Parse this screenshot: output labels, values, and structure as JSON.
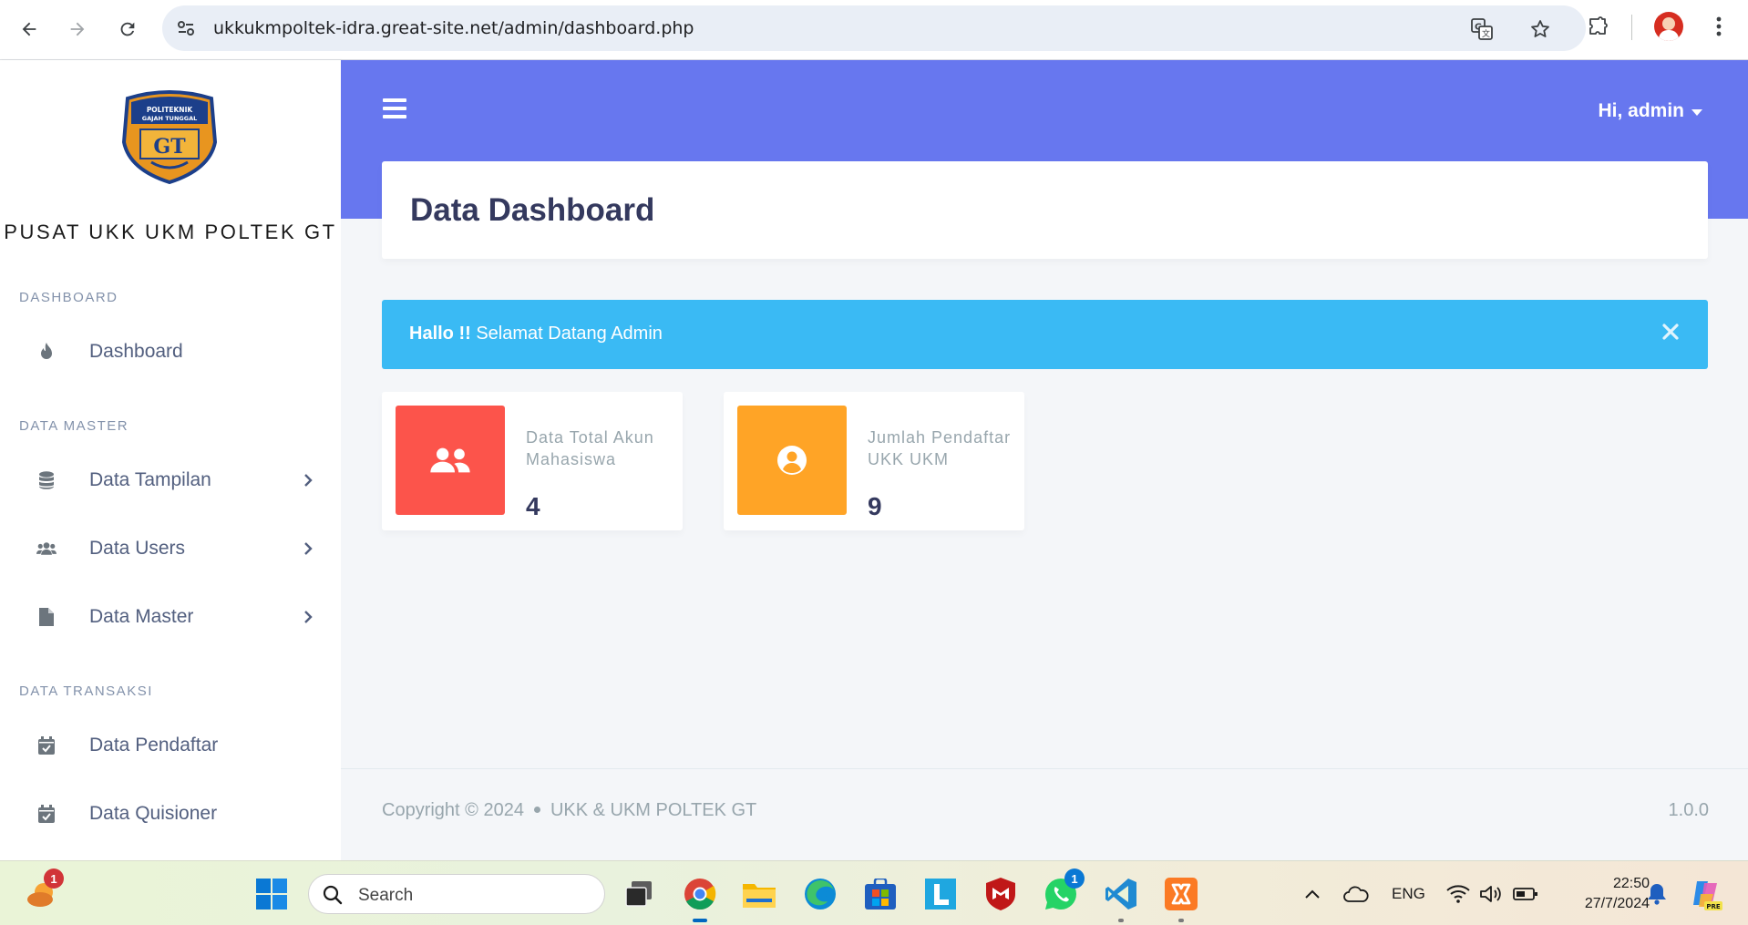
{
  "browser": {
    "url": "ukkukmpoltek-idra.great-site.net/admin/dashboard.php"
  },
  "logo": {
    "line1": "POLITEKNIK",
    "line2": "GAJAH TUNGGAL",
    "mark": "GT"
  },
  "sidebar": {
    "brand": "PUSAT UKK UKM POLTEK GT",
    "sections": [
      {
        "header": "DASHBOARD"
      },
      {
        "header": "DATA MASTER"
      },
      {
        "header": "DATA TRANSAKSI"
      }
    ],
    "items": [
      {
        "label": "Dashboard",
        "icon": "fire-icon"
      },
      {
        "label": "Data Tampilan",
        "icon": "database-icon",
        "has_submenu": true
      },
      {
        "label": "Data Users",
        "icon": "users-icon",
        "has_submenu": true
      },
      {
        "label": "Data Master",
        "icon": "file-icon",
        "has_submenu": true
      },
      {
        "label": "Data Pendaftar",
        "icon": "calendar-check-icon"
      },
      {
        "label": "Data Quisioner",
        "icon": "calendar-check-icon"
      }
    ]
  },
  "topbar": {
    "user_greeting": "Hi, admin"
  },
  "main": {
    "title": "Data Dashboard",
    "alert": {
      "strong": "Hallo !!",
      "message": " Selamat Datang Admin",
      "color": "#3abaf4"
    },
    "stats": [
      {
        "label": "Data Total Akun Mahasiswa",
        "value": "4",
        "icon": "users-icon",
        "color": "#fc544b"
      },
      {
        "label": "Jumlah Pendaftar UKK UKM",
        "value": "9",
        "icon": "user-circle-icon",
        "color": "#ffa426"
      }
    ]
  },
  "footer": {
    "copyright": "Copyright © 2024",
    "site": "UKK & UKM POLTEK GT",
    "version": "1.0.0"
  },
  "taskbar": {
    "search_placeholder": "Search",
    "weather_badge": "1",
    "whatsapp_badge": "1",
    "language": "ENG",
    "time": "22:50",
    "date": "27/7/2024"
  },
  "colors": {
    "primary": "#6777ef",
    "info": "#3abaf4",
    "danger": "#fc544b",
    "warning": "#ffa426"
  }
}
